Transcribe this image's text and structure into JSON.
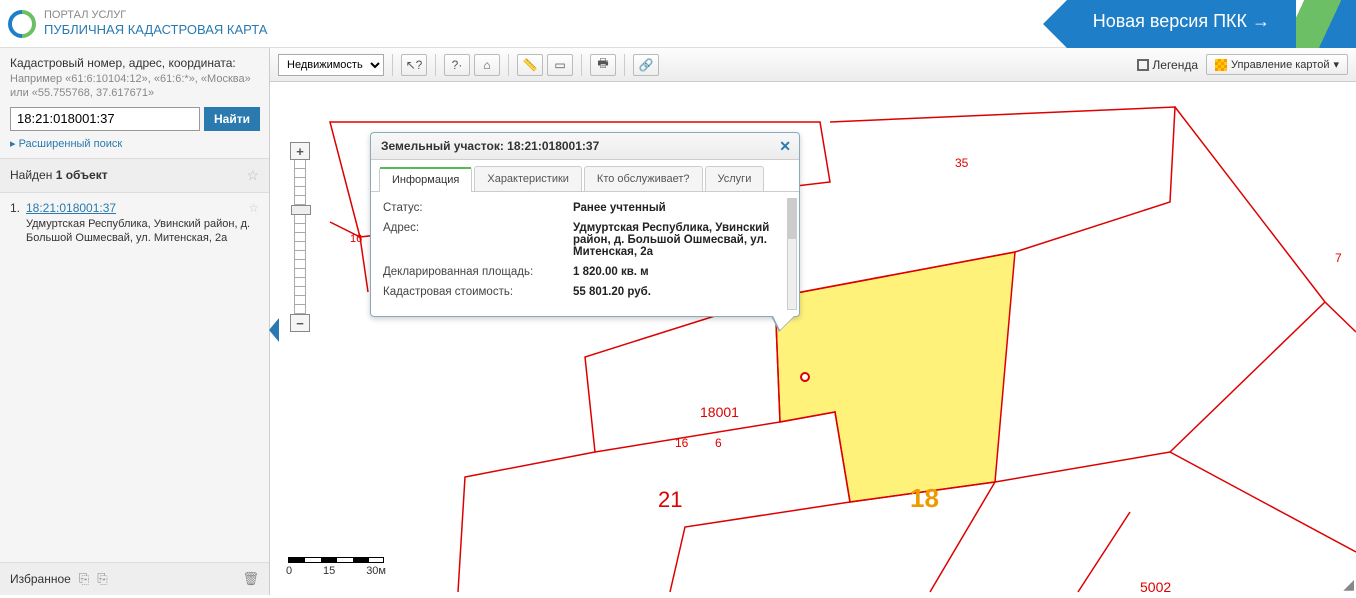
{
  "header": {
    "portal_label": "ПОРТАЛ УСЛУГ",
    "app_title": "ПУБЛИЧНАЯ КАДАСТРОВАЯ КАРТА",
    "new_version_label": "Новая версия ПКК →"
  },
  "sidebar": {
    "search_hint_title": "Кадастровый номер, адрес, координата:",
    "search_hint_example": "Например «61:6:10104:12», «61:6:*», «Москва» или «55.755768, 37.617671»",
    "search_value": "18:21:018001:37",
    "search_button_label": "Найти",
    "advanced_search_label": "Расширенный поиск",
    "found_label_prefix": "Найден ",
    "found_count": "1 объект",
    "results": [
      {
        "num": "1.",
        "link": "18:21:018001:37",
        "address": "Удмуртская Республика, Увинский район, д. Большой Ошмесвай, ул. Митенская, 2а"
      }
    ],
    "favorites_label": "Избранное"
  },
  "toolbar": {
    "object_type_select": "Недвижимость",
    "legend_label": "Легенда",
    "map_control_label": "Управление картой"
  },
  "popup": {
    "title": "Земельный участок: 18:21:018001:37",
    "tabs": [
      "Информация",
      "Характеристики",
      "Кто обслуживает?",
      "Услуги"
    ],
    "active_tab": 0,
    "rows": [
      {
        "label": "Статус:",
        "value": "Ранее учтенный"
      },
      {
        "label": "Адрес:",
        "value": "Удмуртская Республика, Увинский район, д. Большой Ошмесвай, ул. Митенская, 2а"
      },
      {
        "label": "Декларированная площадь:",
        "value": "1 820.00 кв. м"
      },
      {
        "label": "Кадастровая стоимость:",
        "value": "55 801.20 руб."
      }
    ]
  },
  "map": {
    "labels": {
      "block": "18001",
      "p16": "16",
      "p6": "6",
      "p21": "21",
      "p18": "18",
      "p35": "35",
      "p5002": "5002",
      "p7": "7",
      "pleft16": "16"
    },
    "scale": {
      "ticks": [
        "0",
        "15",
        "30м"
      ]
    }
  }
}
